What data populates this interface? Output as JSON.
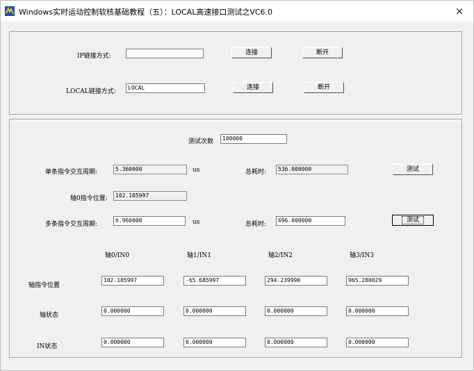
{
  "window": {
    "title": "Windows实时运动控制软核基础教程（五）：LOCAL高速接口测试之VC6.0",
    "close_glyph": "×"
  },
  "connect": {
    "ip_label": "IP链接方式:",
    "ip_value": "",
    "ip_connect": "连接",
    "ip_disconnect": "断开",
    "local_label": "LOCAL链接方式:",
    "local_value": "LOCAL",
    "local_connect": "连接",
    "local_disconnect": "断开"
  },
  "test": {
    "count_label": "测试次数",
    "count_value": "100000",
    "single_label": "单条指令交互周期:",
    "single_value": "5.360000",
    "single_unit": "us",
    "single_total_label": "总耗时:",
    "single_total_value": "536.000000",
    "single_test_button": "测试",
    "axis0_pos_label": "轴0指令位置:",
    "axis0_pos_value": "102.185997",
    "multi_label": "多条指令交互周期:",
    "multi_value": "6.960000",
    "multi_unit": "us",
    "multi_total_label": "总耗时:",
    "multi_total_value": "696.000000",
    "multi_test_button": "测试"
  },
  "grid": {
    "columns": [
      "轴0/IN0",
      "轴1/IN1",
      "轴2/IN2",
      "轴3/IN3"
    ],
    "rows": [
      {
        "label": "轴指令位置",
        "values": [
          "102.185997",
          "-65.685997",
          "294.239990",
          "965.280029"
        ]
      },
      {
        "label": "轴状态",
        "values": [
          "0.000000",
          "0.000000",
          "0.000000",
          "0.000000"
        ]
      },
      {
        "label": "IN状态",
        "values": [
          "0.000000",
          "0.000000",
          "0.000000",
          "0.000000"
        ]
      }
    ]
  }
}
